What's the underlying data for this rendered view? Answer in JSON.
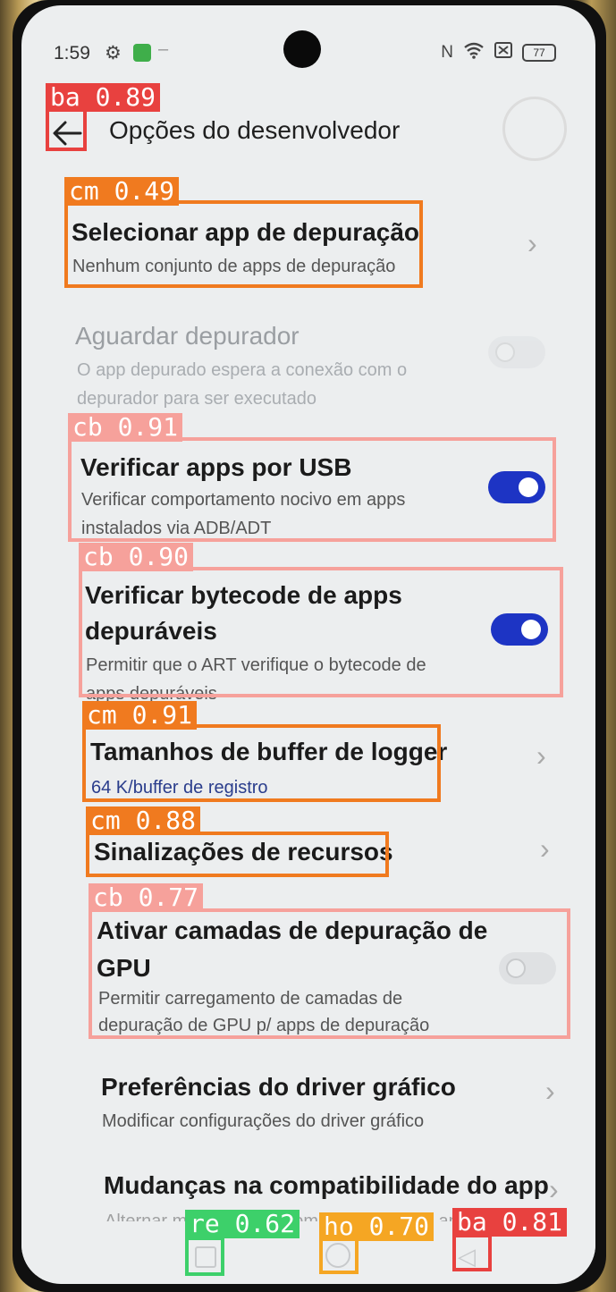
{
  "status_bar": {
    "time": "1:59",
    "battery": "77"
  },
  "header": {
    "title": "Opções do desenvolvedor"
  },
  "items": [
    {
      "title": "Selecionar app de depuração",
      "subtitle": "Nenhum conjunto de apps de depuração",
      "control": "chevron"
    },
    {
      "title": "Aguardar depurador",
      "subtitle_line1": "O app depurado espera a conexão com o",
      "subtitle_line2": "depurador para ser executado",
      "control": "toggle",
      "state": "off",
      "disabled": true
    },
    {
      "title": "Verificar apps por USB",
      "subtitle_line1": "Verificar comportamento nocivo em apps",
      "subtitle_line2": "instalados via ADB/ADT",
      "control": "toggle",
      "state": "on"
    },
    {
      "title_line1": "Verificar bytecode de apps",
      "title_line2": "depuráveis",
      "subtitle_line1": "Permitir que o ART verifique o bytecode de",
      "subtitle_line2": "apps depuráveis",
      "control": "toggle",
      "state": "on"
    },
    {
      "title": "Tamanhos de buffer de logger",
      "subtitle": "64 K/buffer de registro",
      "control": "chevron"
    },
    {
      "title": "Sinalizações de recursos",
      "control": "chevron"
    },
    {
      "title_line1": "Ativar camadas de depuração de",
      "title_line2": "GPU",
      "subtitle_line1": "Permitir carregamento de camadas de",
      "subtitle_line2": "depuração de GPU p/ apps de depuração",
      "control": "toggle",
      "state": "off"
    },
    {
      "title": "Preferências do driver gráfico",
      "subtitle": "Modificar configurações do driver gráfico",
      "control": "chevron"
    },
    {
      "title": "Mudanças na compatibilidade do app",
      "subtitle": "Alternar mudanças na compatibilidade do app",
      "control": "chevron"
    }
  ],
  "detections": [
    {
      "label": "ba 0.89",
      "color": "#e8413f"
    },
    {
      "label": "cm 0.49",
      "color": "#f07a1f"
    },
    {
      "label": "cb 0.91",
      "color": "#f6a19b"
    },
    {
      "label": "cb 0.90",
      "color": "#f6a19b"
    },
    {
      "label": "cm 0.91",
      "color": "#f07a1f"
    },
    {
      "label": "cm 0.88",
      "color": "#f07a1f"
    },
    {
      "label": "cb 0.77",
      "color": "#f6a19b"
    },
    {
      "label": "re 0.62",
      "color": "#3dd06a"
    },
    {
      "label": "ho 0.70",
      "color": "#f5a623"
    },
    {
      "label": "ba 0.81",
      "color": "#e8413f"
    }
  ],
  "colors": {
    "toggle_on": "#1d34c4",
    "screen_bg": "#eceeef"
  }
}
